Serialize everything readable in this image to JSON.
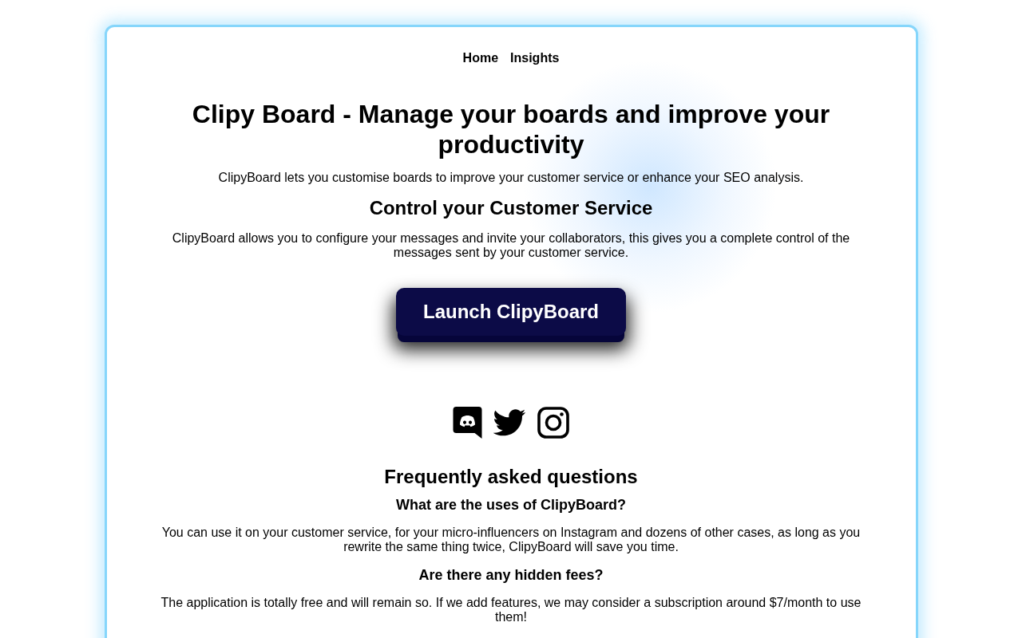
{
  "nav": {
    "links": [
      {
        "label": "Home"
      },
      {
        "label": "Insights"
      }
    ]
  },
  "hero": {
    "title": "Clipy Board - Manage your boards and improve your productivity",
    "subtitle": "ClipyBoard lets you customise boards to improve your customer service or enhance your SEO analysis."
  },
  "section": {
    "heading": "Control your Customer Service",
    "text": "ClipyBoard allows you to configure your messages and invite your collaborators, this gives you a complete control of the messages sent by your customer service."
  },
  "cta": {
    "label": "Launch ClipyBoard"
  },
  "faq": {
    "heading": "Frequently asked questions",
    "items": [
      {
        "question": "What are the uses of ClipyBoard?",
        "answer": "You can use it on your customer service, for your micro-influencers on Instagram and dozens of other cases, as long as you rewrite the same thing twice, ClipyBoard will save you time."
      },
      {
        "question": "Are there any hidden fees?",
        "answer": "The application is totally free and will remain so. If we add features, we may consider a subscription around $7/month to use them!"
      }
    ]
  }
}
